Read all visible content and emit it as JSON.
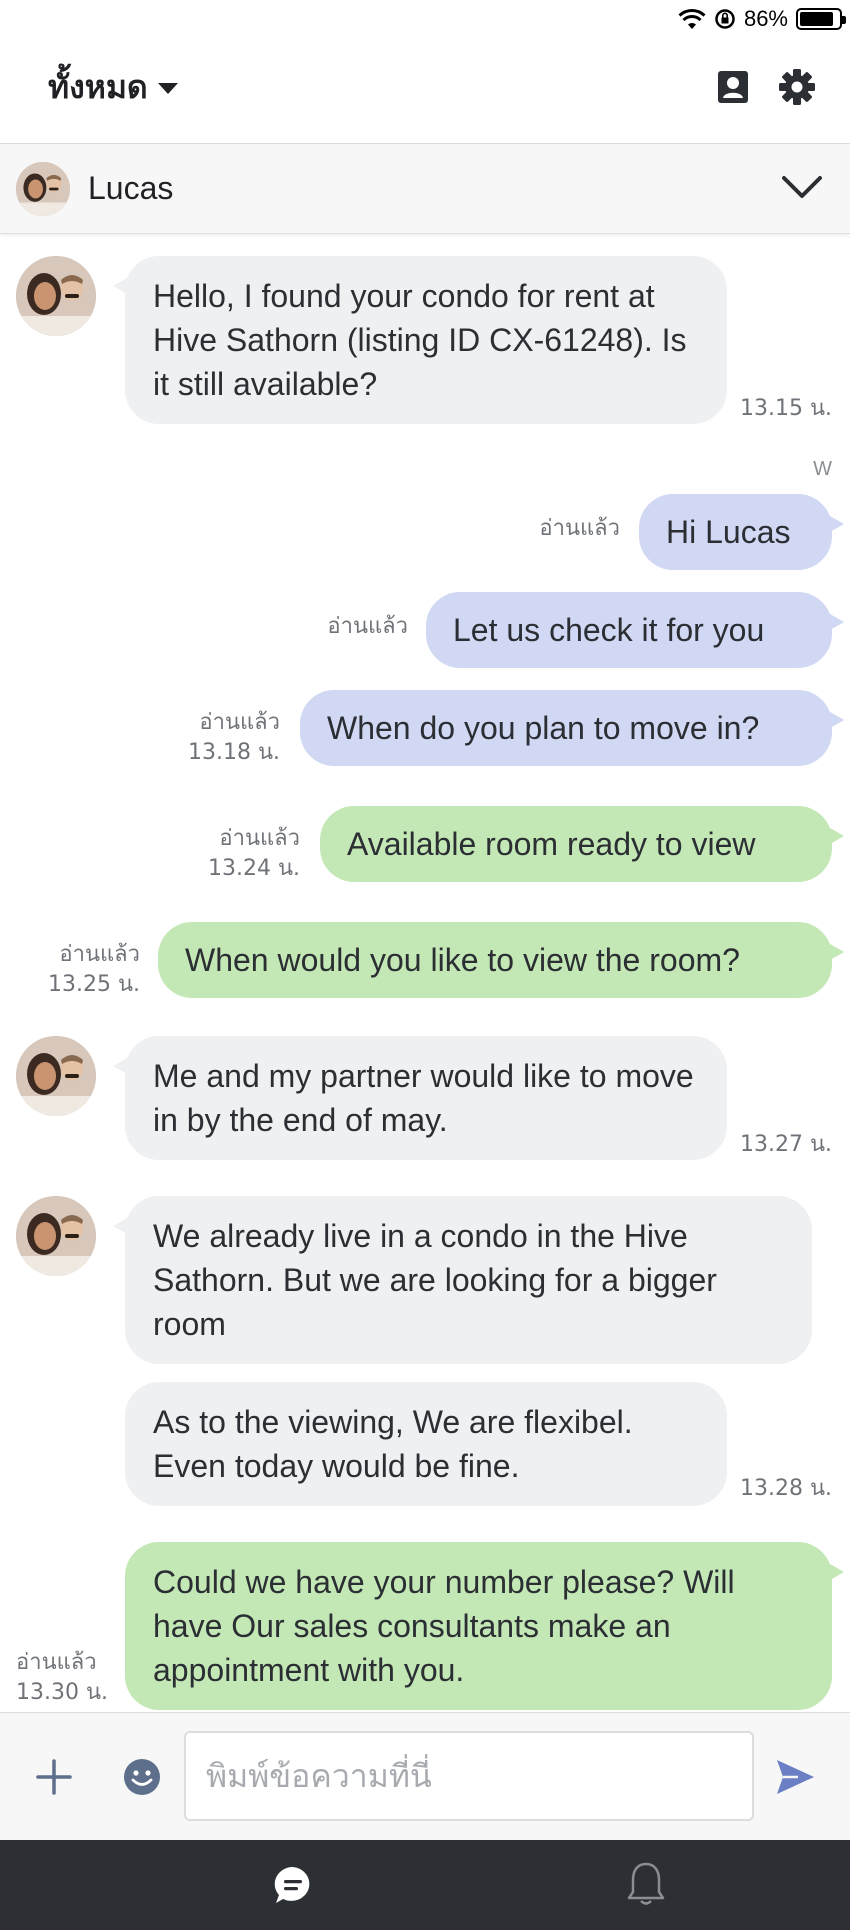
{
  "status_bar": {
    "battery_percent": "86%",
    "battery_level": 0.86,
    "icons": [
      "wifi-icon",
      "orientation-lock-icon",
      "battery-icon"
    ]
  },
  "header": {
    "folder_label": "ทั้งหมด",
    "icons": [
      "contacts-icon",
      "gear-icon",
      "caret-down-icon"
    ]
  },
  "contact": {
    "name": "Lucas",
    "icons": [
      "chevron-down-icon"
    ]
  },
  "messages": [
    {
      "direction": "in",
      "text": "Hello, I found your condo for rent at Hive Sathorn (listing ID CX-61248). Is it still available?",
      "time": "13.15 น."
    },
    {
      "sender_tag": "W"
    },
    {
      "direction": "out",
      "color": "blue",
      "text": "Hi Lucas",
      "read": "อ่านแล้ว"
    },
    {
      "direction": "out",
      "color": "blue",
      "text": "Let us check it for you",
      "read": "อ่านแล้ว"
    },
    {
      "direction": "out",
      "color": "blue",
      "text": "When do you plan to move in?",
      "read": "อ่านแล้ว",
      "time": "13.18 น."
    },
    {
      "direction": "out",
      "color": "green",
      "text": "Available room ready to view",
      "read": "อ่านแล้ว",
      "time": "13.24 น."
    },
    {
      "direction": "out",
      "color": "green",
      "text": "When would you like to view the room?",
      "read": "อ่านแล้ว",
      "time": "13.25 น."
    },
    {
      "direction": "in",
      "text": "Me and my partner would like to move in by the end of may.",
      "time": "13.27 น."
    },
    {
      "direction": "in",
      "text": "We already live in a condo in the Hive Sathorn. But we are looking for a bigger room"
    },
    {
      "direction": "in",
      "text": "As to the viewing, We are flexibel. Even today would be fine.",
      "time": "13.28 น."
    },
    {
      "direction": "out",
      "color": "green",
      "text": "Could we have your number please? Will have Our sales consultants make an appointment with you.",
      "read": "อ่านแล้ว",
      "time": "13.30 น."
    }
  ],
  "input": {
    "placeholder": "พิมพ์ข้อความที่นี่",
    "value": "",
    "icons": [
      "plus-icon",
      "emoji-icon",
      "send-icon"
    ]
  },
  "bottom_nav": {
    "icons": [
      "chat-icon",
      "bell-icon"
    ]
  },
  "colors": {
    "incoming_bubble": "#eff0f2",
    "blue_bubble": "#d0d8f3",
    "green_bubble": "#c3e8b6",
    "nav_bar": "#2c2f33",
    "send_icon": "#6a7fc4"
  }
}
